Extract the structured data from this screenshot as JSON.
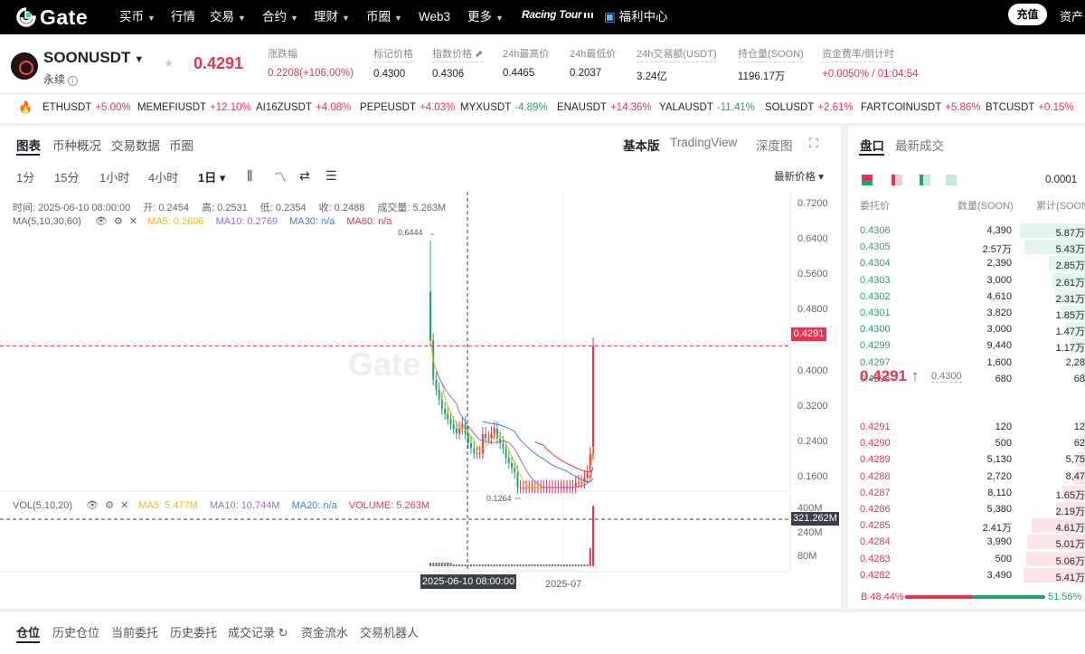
{
  "nav": {
    "logo": "Gate",
    "items": [
      {
        "label": "买币",
        "caret": true
      },
      {
        "label": "行情",
        "caret": false
      },
      {
        "label": "交易",
        "caret": true
      },
      {
        "label": "合约",
        "caret": true
      },
      {
        "label": "理财",
        "caret": true
      },
      {
        "label": "币圈",
        "caret": true
      },
      {
        "label": "Web3",
        "caret": false
      },
      {
        "label": "更多",
        "caret": true
      }
    ],
    "racing": "Racing Tour",
    "welfare": "福利中心",
    "deposit": "充值",
    "assets": "资产"
  },
  "ticker": {
    "pair": "SOONUSDT",
    "type": "永续",
    "last_price": "0.4291",
    "stats": [
      {
        "label": "涨跌幅",
        "value": "0.2208(+106.00%)",
        "red": true
      },
      {
        "label": "标记价格",
        "value": "0.4300"
      },
      {
        "label": "指数价格 ⬈",
        "value": "0.4306"
      },
      {
        "label": "24h最高价",
        "value": "0.4465"
      },
      {
        "label": "24h最低价",
        "value": "0.2037"
      },
      {
        "label": "24h交易额(USDT)",
        "value": "3.24亿"
      },
      {
        "label": "持仓量(SOON)",
        "value": "1196.17万"
      },
      {
        "label": "资金费率/倒计时",
        "value": "+0.0050% / 01:04:54",
        "red": true
      }
    ]
  },
  "hot_tickers": [
    {
      "sym": "ETHUSDT",
      "chg": "+5.00%",
      "up": true
    },
    {
      "sym": "MEMEFIUSDT",
      "chg": "+12.10%",
      "up": true
    },
    {
      "sym": "AI16ZUSDT",
      "chg": "+4.08%",
      "up": true
    },
    {
      "sym": "PEPEUSDT",
      "chg": "+4.03%",
      "up": true
    },
    {
      "sym": "MYXUSDT",
      "chg": "-4.89%",
      "up": false
    },
    {
      "sym": "ENAUSDT",
      "chg": "+14.36%",
      "up": true
    },
    {
      "sym": "YALAUSDT",
      "chg": "-11.41%",
      "up": false
    },
    {
      "sym": "SOLUSDT",
      "chg": "+2.61%",
      "up": true
    },
    {
      "sym": "FARTCOINUSDT",
      "chg": "+5.86%",
      "up": true
    },
    {
      "sym": "BTCUSDT",
      "chg": "+0.15%",
      "up": true
    }
  ],
  "chart_tabs": [
    "图表",
    "币种概况",
    "交易数据",
    "币圈"
  ],
  "chart_views": [
    "基本版",
    "TradingView",
    "深度图"
  ],
  "timeframes": [
    "1分",
    "15分",
    "1小时",
    "4小时",
    "1日 ▾"
  ],
  "price_type": "最新价格 ▾",
  "ohlc": {
    "time": "时间: 2025-06-10 08:00:00",
    "open": "开: 0.2454",
    "high": "高: 0.2531",
    "low": "低: 0.2354",
    "close": "收: 0.2488",
    "volume": "成交量: 5.263M"
  },
  "ma": {
    "label": "MA(5,10,30,60)",
    "ma5": "MA5: 0.2606",
    "ma10": "MA10: 0.2769",
    "ma30": "MA30: n/a",
    "ma60": "MA60: n/a"
  },
  "vol": {
    "label": "VOL(5,10,20)",
    "ma5": "MA5: 5.477M",
    "ma10": "MA10: 10.744M",
    "ma20": "MA20: n/a",
    "volume": "VOLUME: 5.263M"
  },
  "price_axis": [
    "0.7200",
    "0.6400",
    "0.5600",
    "0.4800",
    "0.4000",
    "0.3200",
    "0.2400",
    "0.1600"
  ],
  "vol_axis": [
    "400M",
    "240M",
    "80M"
  ],
  "current_price_tag": "0.4291",
  "crosshair_vol_tag": "321.262M",
  "crosshair_date": "2025-06-10 08:00:00",
  "x_labels": [
    "2025-07"
  ],
  "chart_high_label": "0.6444",
  "chart_low_label": "0.1264",
  "watermark": "Gate",
  "colors": {
    "up": "#e8344e",
    "down": "#26a36b",
    "ma5": "#f0b90b",
    "ma10": "#a066d3",
    "ma30": "#3d7fd9",
    "ma60": "#e8344e"
  },
  "chart_data": {
    "type": "candlestick",
    "interval": "1日",
    "x_range": [
      "2025-05-23",
      "2025-07-23"
    ],
    "ylim": [
      0.08,
      0.74
    ],
    "high": 0.6444,
    "low": 0.1264,
    "last": 0.4291,
    "crosshair_candle": {
      "time": "2025-06-10 08:00:00",
      "open": 0.2454,
      "high": 0.2531,
      "low": 0.2354,
      "close": 0.2488,
      "volume": "5.263M"
    },
    "closes": [
      0.44,
      0.36,
      0.34,
      0.32,
      0.3,
      0.29,
      0.28,
      0.27,
      0.26,
      0.25,
      0.26,
      0.27,
      0.25,
      0.23,
      0.22,
      0.21,
      0.21,
      0.21,
      0.2488,
      0.24,
      0.24,
      0.25,
      0.26,
      0.24,
      0.23,
      0.22,
      0.2,
      0.19,
      0.18,
      0.17,
      0.14,
      0.14,
      0.14,
      0.14,
      0.14,
      0.14,
      0.14,
      0.14,
      0.14,
      0.14,
      0.14,
      0.14,
      0.14,
      0.14,
      0.14,
      0.14,
      0.14,
      0.14,
      0.14,
      0.14,
      0.15,
      0.15,
      0.15,
      0.16,
      0.17,
      0.2083,
      0.4291
    ]
  },
  "book": {
    "tabs": [
      "盘口",
      "最新成交"
    ],
    "step": "0.0001",
    "headers": [
      "委托价",
      "数量(SOON)",
      "累计(SOON)"
    ],
    "asks": [
      {
        "price": "0.4306",
        "qty": "4,390",
        "cum": "5.87万",
        "depth": 0.95
      },
      {
        "price": "0.4305",
        "qty": "2.57万",
        "cum": "5.43万",
        "depth": 0.88
      },
      {
        "price": "0.4304",
        "qty": "2,390",
        "cum": "2.85万",
        "depth": 0.53
      },
      {
        "price": "0.4303",
        "qty": "3,000",
        "cum": "2.61万",
        "depth": 0.48
      },
      {
        "price": "0.4302",
        "qty": "4,610",
        "cum": "2.31万",
        "depth": 0.43
      },
      {
        "price": "0.4301",
        "qty": "3,820",
        "cum": "1.85万",
        "depth": 0.35
      },
      {
        "price": "0.4300",
        "qty": "3,000",
        "cum": "1.47万",
        "depth": 0.28
      },
      {
        "price": "0.4299",
        "qty": "9,440",
        "cum": "1.17万",
        "depth": 0.22
      },
      {
        "price": "0.4297",
        "qty": "1,600",
        "cum": "2,28",
        "depth": 0.06
      },
      {
        "price": "0.4296",
        "qty": "680",
        "cum": "68",
        "depth": 0.03
      }
    ],
    "mid_price": "0.4291 ↑",
    "mark": "0.4300",
    "bids": [
      {
        "price": "0.4291",
        "qty": "120",
        "cum": "12",
        "depth": 0.02
      },
      {
        "price": "0.4290",
        "qty": "500",
        "cum": "62",
        "depth": 0.03
      },
      {
        "price": "0.4289",
        "qty": "5,130",
        "cum": "5,75",
        "depth": 0.12
      },
      {
        "price": "0.4288",
        "qty": "2,720",
        "cum": "8,47",
        "depth": 0.16
      },
      {
        "price": "0.4287",
        "qty": "8,110",
        "cum": "1.65万",
        "depth": 0.33
      },
      {
        "price": "0.4286",
        "qty": "5,380",
        "cum": "2.19万",
        "depth": 0.42
      },
      {
        "price": "0.4285",
        "qty": "2.41万",
        "cum": "4.61万",
        "depth": 0.78
      },
      {
        "price": "0.4284",
        "qty": "3,990",
        "cum": "5.01万",
        "depth": 0.84
      },
      {
        "price": "0.4283",
        "qty": "500",
        "cum": "5.06万",
        "depth": 0.85
      },
      {
        "price": "0.4282",
        "qty": "3,490",
        "cum": "5.41万",
        "depth": 0.9
      }
    ],
    "buy_ratio": "B 48.44%",
    "sell_ratio": "51.56%",
    "buy_share": 0.4844
  },
  "position_tabs": [
    "仓位",
    "历史仓位",
    "当前委托",
    "历史委托",
    "成交记录 ↻",
    "资金流水",
    "交易机器人"
  ]
}
